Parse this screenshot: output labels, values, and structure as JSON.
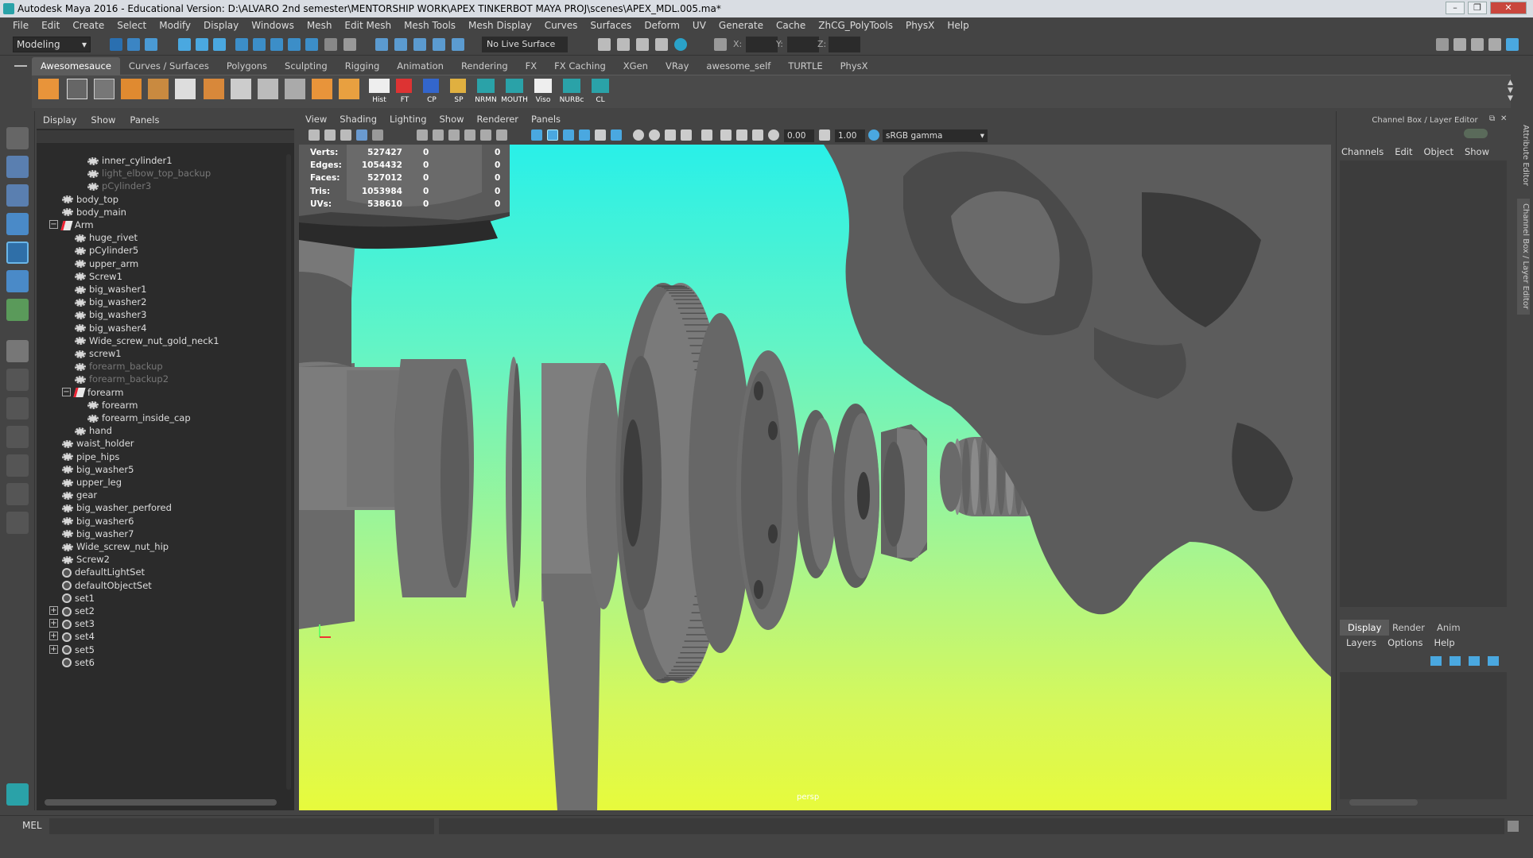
{
  "window": {
    "title": "Autodesk Maya 2016 - Educational Version: D:\\ALVARO 2nd semester\\MENTORSHIP WORK\\APEX TINKERBOT MAYA PROJ\\scenes\\APEX_MDL.005.ma*"
  },
  "menubar": [
    "File",
    "Edit",
    "Create",
    "Select",
    "Modify",
    "Display",
    "Windows",
    "Mesh",
    "Edit Mesh",
    "Mesh Tools",
    "Mesh Display",
    "Curves",
    "Surfaces",
    "Deform",
    "UV",
    "Generate",
    "Cache",
    "ZhCG_PolyTools",
    "PhysX",
    "Help"
  ],
  "statusline": {
    "mode": "Modeling",
    "live_surface": "No Live Surface",
    "x_label": "X:",
    "y_label": "Y:",
    "z_label": "Z:"
  },
  "shelf": {
    "tabs": [
      "Awesomesauce",
      "Curves / Surfaces",
      "Polygons",
      "Sculpting",
      "Rigging",
      "Animation",
      "Rendering",
      "FX",
      "FX Caching",
      "XGen",
      "VRay",
      "awesome_self",
      "TURTLE",
      "PhysX"
    ],
    "active_tab": "Awesomesauce",
    "labeled_buttons": [
      "Hist",
      "FT",
      "CP",
      "SP",
      "NRMN",
      "MOUTH",
      "Viso",
      "NURBc",
      "CL"
    ]
  },
  "outliner": {
    "menu": [
      "Display",
      "Show",
      "Panels"
    ],
    "items": [
      {
        "label": "inner_cylinder1",
        "dim": false
      },
      {
        "label": "light_elbow_top_backup",
        "dim": true
      },
      {
        "label": "pCylinder3",
        "dim": true
      },
      {
        "label": "body_top",
        "dim": false
      },
      {
        "label": "body_main",
        "dim": false
      },
      {
        "label": "Arm",
        "dim": false
      },
      {
        "label": "huge_rivet",
        "dim": false
      },
      {
        "label": "pCylinder5",
        "dim": false
      },
      {
        "label": "upper_arm",
        "dim": false
      },
      {
        "label": "Screw1",
        "dim": false
      },
      {
        "label": "big_washer1",
        "dim": false
      },
      {
        "label": "big_washer2",
        "dim": false
      },
      {
        "label": "big_washer3",
        "dim": false
      },
      {
        "label": "big_washer4",
        "dim": false
      },
      {
        "label": "Wide_screw_nut_gold_neck1",
        "dim": false
      },
      {
        "label": "screw1",
        "dim": false
      },
      {
        "label": "forearm_backup",
        "dim": true
      },
      {
        "label": "forearm_backup2",
        "dim": true
      },
      {
        "label": "forearm",
        "dim": false
      },
      {
        "label": "forearm",
        "dim": false
      },
      {
        "label": "forearm_inside_cap",
        "dim": false
      },
      {
        "label": "hand",
        "dim": false
      },
      {
        "label": "waist_holder",
        "dim": false
      },
      {
        "label": "pipe_hips",
        "dim": false
      },
      {
        "label": "big_washer5",
        "dim": false
      },
      {
        "label": "upper_leg",
        "dim": false
      },
      {
        "label": "gear",
        "dim": false
      },
      {
        "label": "big_washer_perfored",
        "dim": false
      },
      {
        "label": "big_washer6",
        "dim": false
      },
      {
        "label": "big_washer7",
        "dim": false
      },
      {
        "label": "Wide_screw_nut_hip",
        "dim": false
      },
      {
        "label": "Screw2",
        "dim": false
      },
      {
        "label": "defaultLightSet",
        "dim": false
      },
      {
        "label": "defaultObjectSet",
        "dim": false
      },
      {
        "label": "set1",
        "dim": false
      },
      {
        "label": "set2",
        "dim": false
      },
      {
        "label": "set3",
        "dim": false
      },
      {
        "label": "set4",
        "dim": false
      },
      {
        "label": "set5",
        "dim": false
      },
      {
        "label": "set6",
        "dim": false
      }
    ]
  },
  "viewport": {
    "menu": [
      "View",
      "Shading",
      "Lighting",
      "Show",
      "Renderer",
      "Panels"
    ],
    "exposure": "0.00",
    "gamma": "1.00",
    "color_space": "sRGB gamma",
    "camera_label": "persp",
    "hud": [
      {
        "key": "Verts:",
        "value": "527427",
        "a": "0",
        "b": "0"
      },
      {
        "key": "Edges:",
        "value": "1054432",
        "a": "0",
        "b": "0"
      },
      {
        "key": "Faces:",
        "value": "527012",
        "a": "0",
        "b": "0"
      },
      {
        "key": "Tris:",
        "value": "1053984",
        "a": "0",
        "b": "0"
      },
      {
        "key": "UVs:",
        "value": "538610",
        "a": "0",
        "b": "0"
      }
    ]
  },
  "channel_box": {
    "title": "Channel Box / Layer Editor",
    "menu": [
      "Channels",
      "Edit",
      "Object",
      "Show"
    ],
    "layer_tabs": [
      "Display",
      "Render",
      "Anim"
    ],
    "active_layer_tab": "Display",
    "layer_menu": [
      "Layers",
      "Options",
      "Help"
    ]
  },
  "side_tabs": [
    "Attribute Editor",
    "Channel Box / Layer Editor"
  ],
  "command_line": {
    "label": "MEL"
  },
  "colors": {
    "viewport_top": "#29f0e8",
    "viewport_bottom": "#e7fa3c",
    "ui_bg": "#444444",
    "panel_dark": "#2b2b2b",
    "accent_blue": "#4aa8e0"
  }
}
